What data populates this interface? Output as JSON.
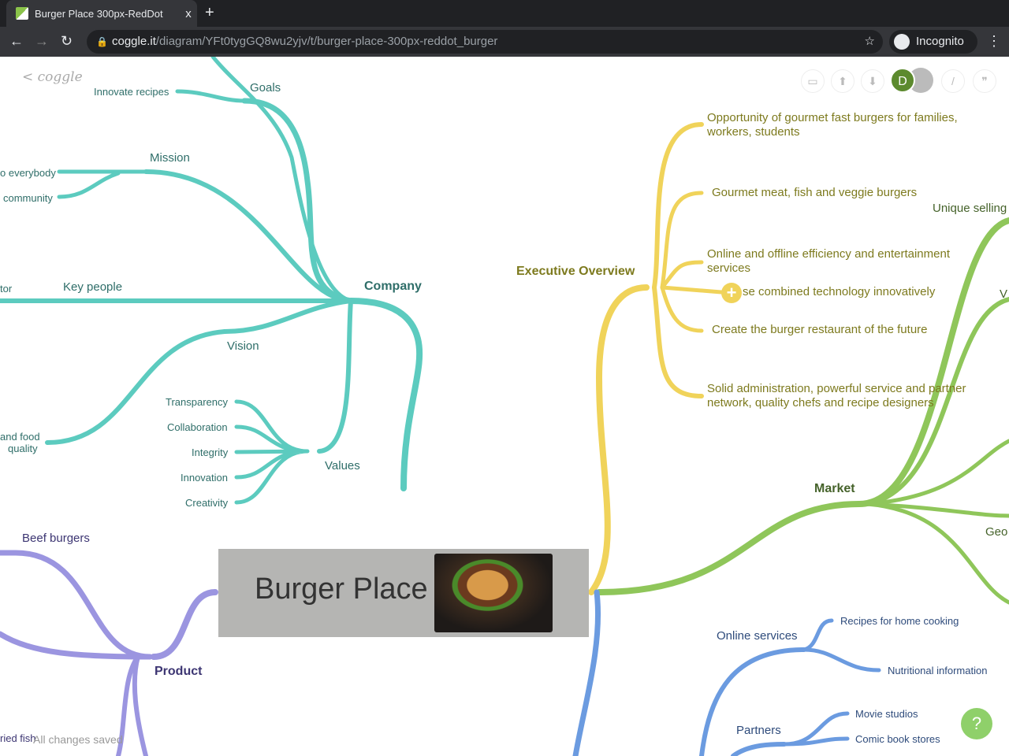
{
  "browser": {
    "tab_title": "Burger Place 300px-RedDot",
    "close": "x",
    "new_tab": "+",
    "url_host": "coggle.it",
    "url_path": "/diagram/YFt0tygGQ8wu2yjv/t/burger-place-300px-reddot_burger",
    "incognito": "Incognito"
  },
  "app": {
    "logo": "< coggle",
    "status": "All changes saved",
    "help": "?",
    "avatar": "D"
  },
  "colors": {
    "company": "#5ccbbf",
    "overview": "#f0d35a",
    "market": "#8fc65a",
    "services": "#6b9be0",
    "product": "#9b95e0"
  },
  "root": {
    "title": "Burger Place"
  },
  "company": {
    "label": "Company",
    "goals": "Goals",
    "innovate": "Innovate recipes",
    "mission": "Mission",
    "mission_items": [
      "o everybody",
      "community"
    ],
    "key_people": "Key people",
    "key_people_item": "tor",
    "vision": "Vision",
    "vision_item": [
      "and food",
      "quality"
    ],
    "values": "Values",
    "values_items": [
      "Transparency",
      "Collaboration",
      "Integrity",
      "Innovation",
      "Creativity"
    ]
  },
  "overview": {
    "label": "Executive Overview",
    "items": [
      "Opportunity of gourmet fast burgers for families, workers, students",
      "Gourmet meat, fish and veggie burgers",
      "Online and offline efficiency and entertainment services",
      "se combined technology innovatively",
      "Create the burger restaurant of the future",
      "Solid administration, powerful service and partner network, quality chefs and recipe designers"
    ]
  },
  "market": {
    "label": "Market",
    "items": [
      "Unique selling",
      "V",
      "Geo"
    ]
  },
  "services": {
    "online": "Online services",
    "online_items": [
      "Recipes for home cooking",
      "Nutritional information"
    ],
    "partners": "Partners",
    "partner_items": [
      "Movie studios",
      "Comic book stores"
    ]
  },
  "product": {
    "label": "Product",
    "beef": "Beef burgers",
    "fish": "ried fish"
  }
}
